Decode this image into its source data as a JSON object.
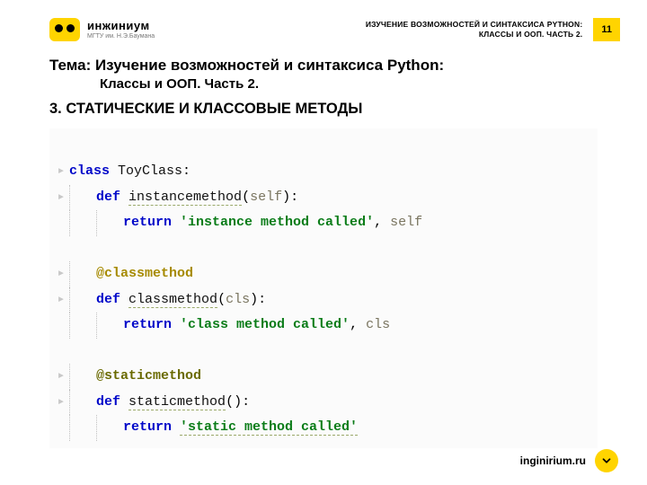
{
  "logo": {
    "name": "инжиниум",
    "sub": "МГТУ им. Н.Э.Баумана"
  },
  "header": {
    "line1": "ИЗУЧЕНИЕ ВОЗМОЖНОСТЕЙ И СИНТАКСИСА PYTHON:",
    "line2": "КЛАССЫ И ООП. ЧАСТЬ 2.",
    "slide": "11"
  },
  "topic": {
    "line": "Тема: Изучение возможностей и синтаксиса Python:",
    "sub": "Классы и ООП. Часть 2."
  },
  "section": "3. СТАТИЧЕСКИЕ И КЛАССОВЫЕ МЕТОДЫ",
  "code": {
    "class_kw": "class",
    "class_name": "ToyClass",
    "def": "def",
    "ret": "return",
    "m1": "instancemethod",
    "m1p": "self",
    "m1s": "'instance method called'",
    "m1t": "self",
    "dec1": "@classmethod",
    "m2": "classmethod",
    "m2p": "cls",
    "m2s": "'class method called'",
    "m2t": "cls",
    "dec2": "@staticmethod",
    "m3": "staticmethod",
    "m3s": "'static method called'"
  },
  "footer": {
    "url": "inginirium.ru"
  }
}
